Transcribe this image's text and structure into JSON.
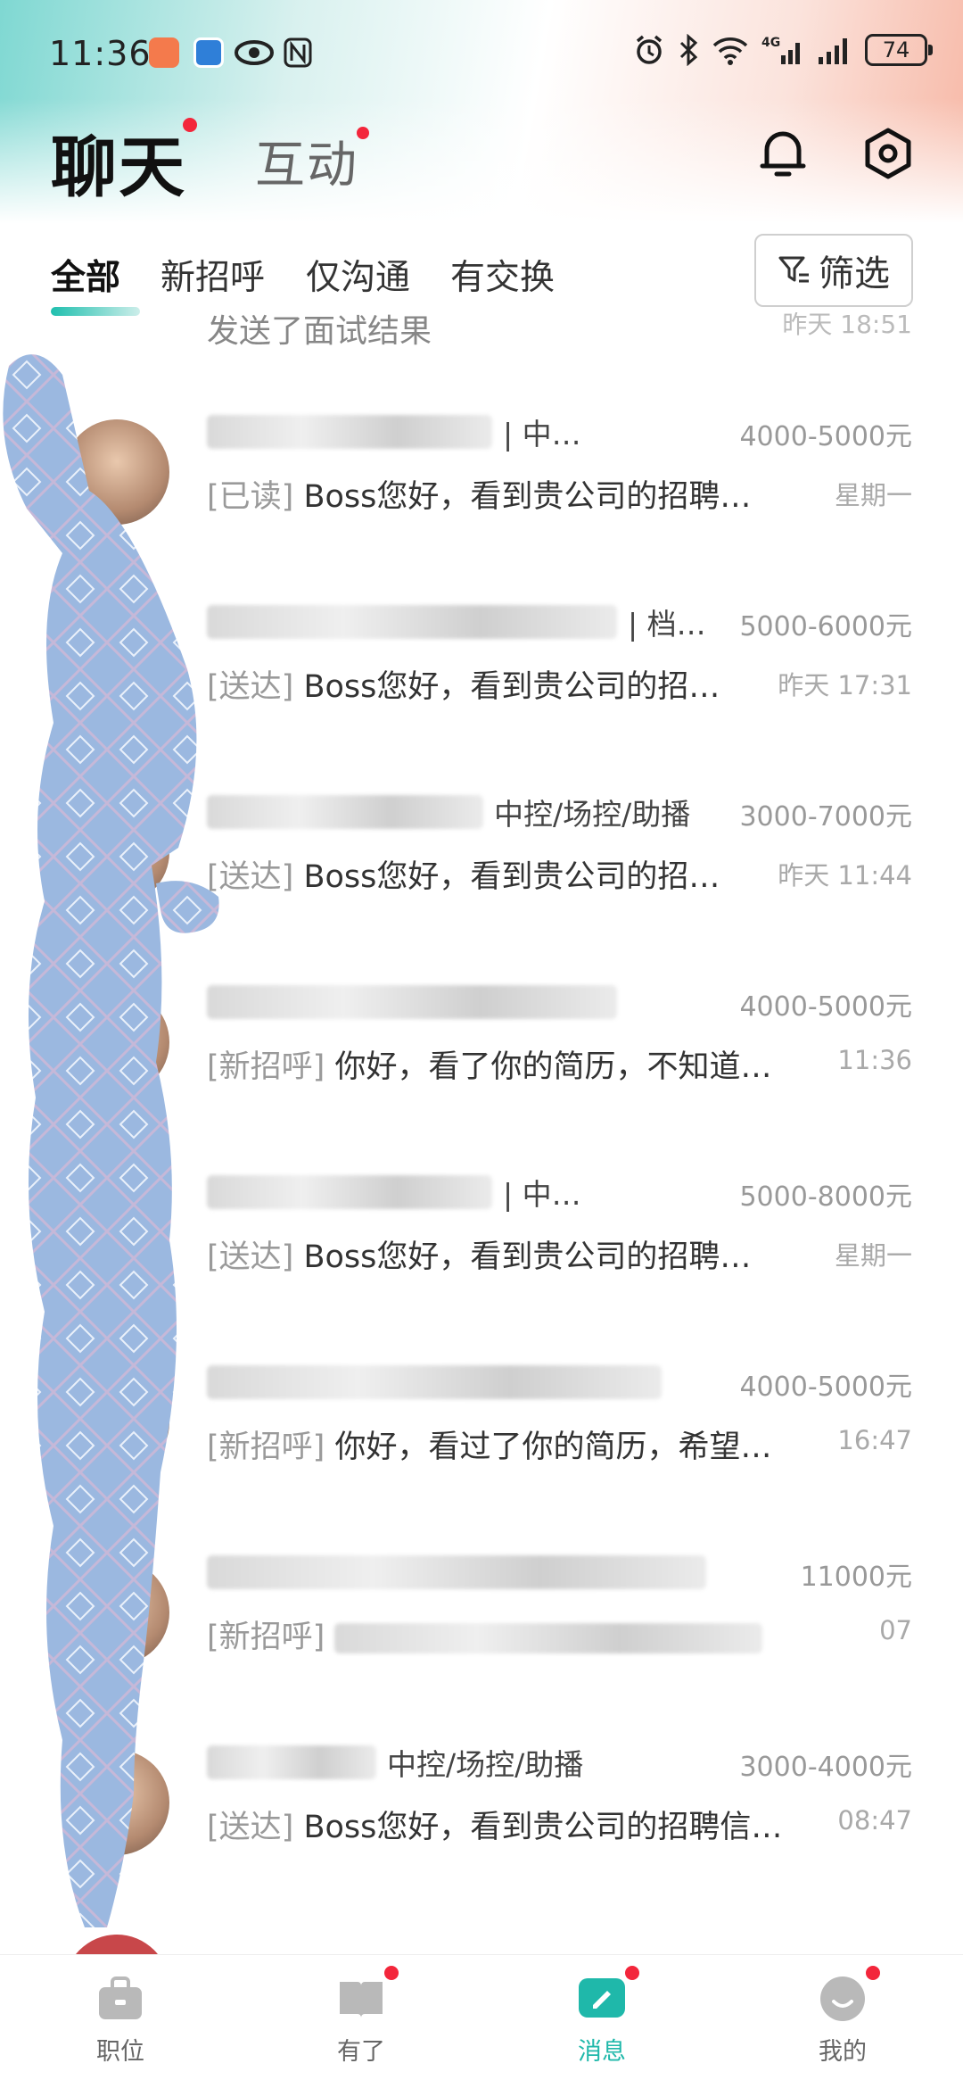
{
  "status_bar": {
    "time": "11:36",
    "battery": "74",
    "icons": [
      "alarm-icon",
      "bluetooth-icon",
      "wifi-icon",
      "4g-signal-icon",
      "signal-icon"
    ]
  },
  "header": {
    "title": "聊天",
    "tab2": "互动",
    "bell_icon": "bell-icon",
    "settings_icon": "settings-icon"
  },
  "filters": {
    "tabs": [
      "全部",
      "新招呼",
      "仅沟通",
      "有交换"
    ],
    "active": "全部",
    "filter_button": "筛选"
  },
  "partial_top": {
    "text": "发送了面试结果",
    "time": "昨天 18:51"
  },
  "chats": [
    {
      "job": "| 中…",
      "salary": "4000-5000元",
      "status": "[已读]",
      "message": "Boss您好，看到贵公司的招聘…",
      "time": "星期一"
    },
    {
      "job": "| 档…",
      "salary": "5000-6000元",
      "status": "[送达]",
      "message": "Boss您好，看到贵公司的招…",
      "time": "昨天 17:31"
    },
    {
      "job": "中控/场控/助播",
      "salary": "3000-7000元",
      "status": "[送达]",
      "message": "Boss您好，看到贵公司的招…",
      "time": "昨天 11:44"
    },
    {
      "job": "",
      "salary": "4000-5000元",
      "status": "[新招呼]",
      "message": "你好，看了你的简历，不知道…",
      "time": "11:36"
    },
    {
      "job": "| 中…",
      "salary": "5000-8000元",
      "status": "[送达]",
      "message": "Boss您好，看到贵公司的招聘…",
      "time": "星期一"
    },
    {
      "job": "",
      "salary": "4000-5000元",
      "status": "[新招呼]",
      "message": "你好，看过了你的简历，希望…",
      "time": "16:47"
    },
    {
      "job": "",
      "salary": "11000元",
      "status": "[新招呼]",
      "message": "",
      "time": "07"
    },
    {
      "job": "中控/场控/助播",
      "salary": "3000-4000元",
      "status": "[送达]",
      "message": "Boss您好，看到贵公司的招聘信…",
      "time": "08:47"
    }
  ],
  "bottom_nav": [
    {
      "label": "职位",
      "icon": "briefcase-icon",
      "active": false,
      "dot": false
    },
    {
      "label": "有了",
      "icon": "book-icon",
      "active": false,
      "dot": true
    },
    {
      "label": "消息",
      "icon": "message-icon",
      "active": true,
      "dot": true
    },
    {
      "label": "我的",
      "icon": "profile-icon",
      "active": false,
      "dot": true
    }
  ],
  "colors": {
    "accent": "#1fb8aa",
    "badge": "#f3263b"
  }
}
